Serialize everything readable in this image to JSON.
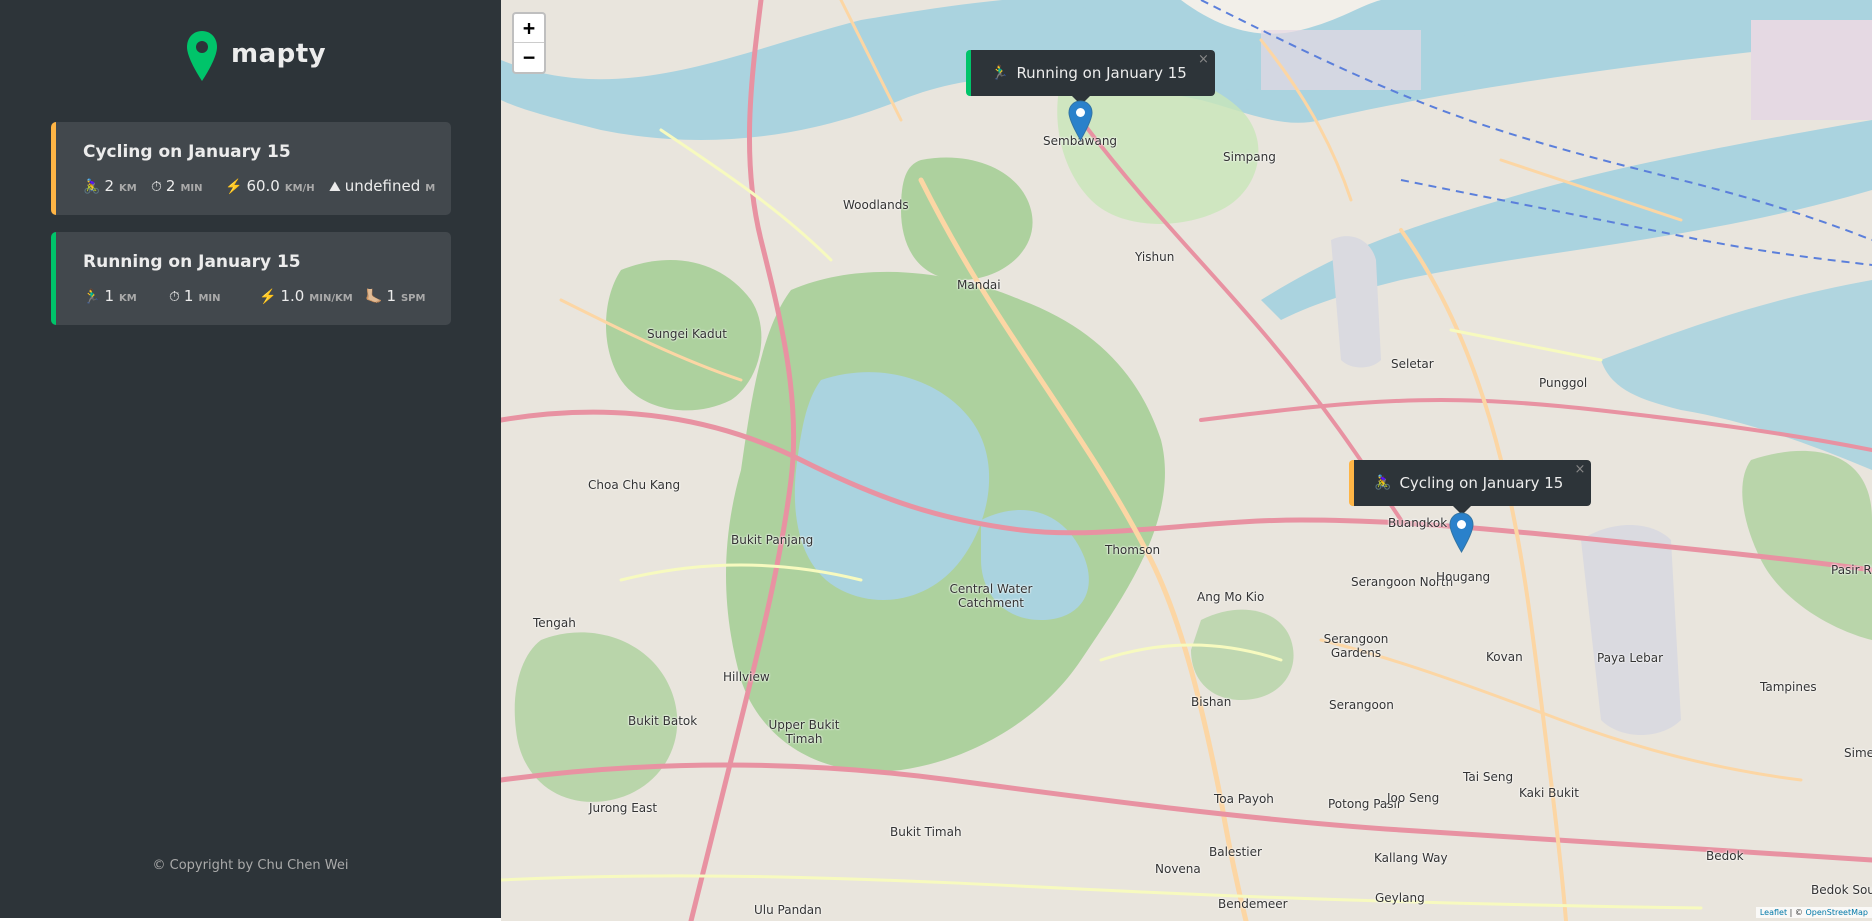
{
  "brand": {
    "name": "mapty",
    "logo_icon": "map-pin-icon",
    "accent_green": "#00c46a",
    "accent_orange": "#ffb545"
  },
  "workouts": [
    {
      "type": "cycling",
      "title": "Cycling on January 15",
      "details": [
        {
          "icon": "🚴‍♀️",
          "value": "2",
          "unit": "km"
        },
        {
          "icon": "⏱",
          "value": "2",
          "unit": "min"
        },
        {
          "icon": "⚡️",
          "value": "60.0",
          "unit": "km/h"
        },
        {
          "icon": "⛰",
          "value": "undefined",
          "unit": "m"
        }
      ]
    },
    {
      "type": "running",
      "title": "Running on January 15",
      "details": [
        {
          "icon": "🏃‍♂️",
          "value": "1",
          "unit": "km"
        },
        {
          "icon": "⏱",
          "value": "1",
          "unit": "min"
        },
        {
          "icon": "⚡️",
          "value": "1.0",
          "unit": "min/km"
        },
        {
          "icon": "🦶🏼",
          "value": "1",
          "unit": "spm"
        }
      ]
    }
  ],
  "copyright": "© Copyright by Chu Chen Wei",
  "map": {
    "zoom_in": "+",
    "zoom_out": "−",
    "popups": {
      "running": {
        "icon": "🏃‍♂️",
        "text": "Running on January 15",
        "close": "×"
      },
      "cycling": {
        "icon": "🚴‍♀️",
        "text": "Cycling on January 15",
        "close": "×"
      }
    },
    "attribution": {
      "leaflet": "Leaflet",
      "sep": " | © ",
      "osm": "OpenStreetMap"
    },
    "places": [
      "Woodlands",
      "Sembawang",
      "Simpang",
      "Mandai",
      "Yishun",
      "Sungei Kadut",
      "Seletar",
      "Punggol",
      "Choa Chu Kang",
      "Bukit Panjang",
      "Buangkok",
      "Serangoon North",
      "Hougang",
      "Thomson",
      "Ang Mo Kio",
      "Central Water Catchment",
      "Tengah",
      "Serangoon Gardens",
      "Kovan",
      "Hillview",
      "Bishan",
      "Serangoon",
      "Bukit Batok",
      "Upper Bukit Timah",
      "Paya Lebar",
      "Tampines",
      "Toa Payoh",
      "Potong Pasir",
      "Joo Seng",
      "Kaki Bukit",
      "Tai Seng",
      "Jurong East",
      "Bukit Timah",
      "Balestier",
      "Kallang Way",
      "Novena",
      "Bedok",
      "Ulu Pandan",
      "Bendemeer",
      "Geylang",
      "Pasir Ris",
      "Bedok South",
      "Simei"
    ]
  }
}
